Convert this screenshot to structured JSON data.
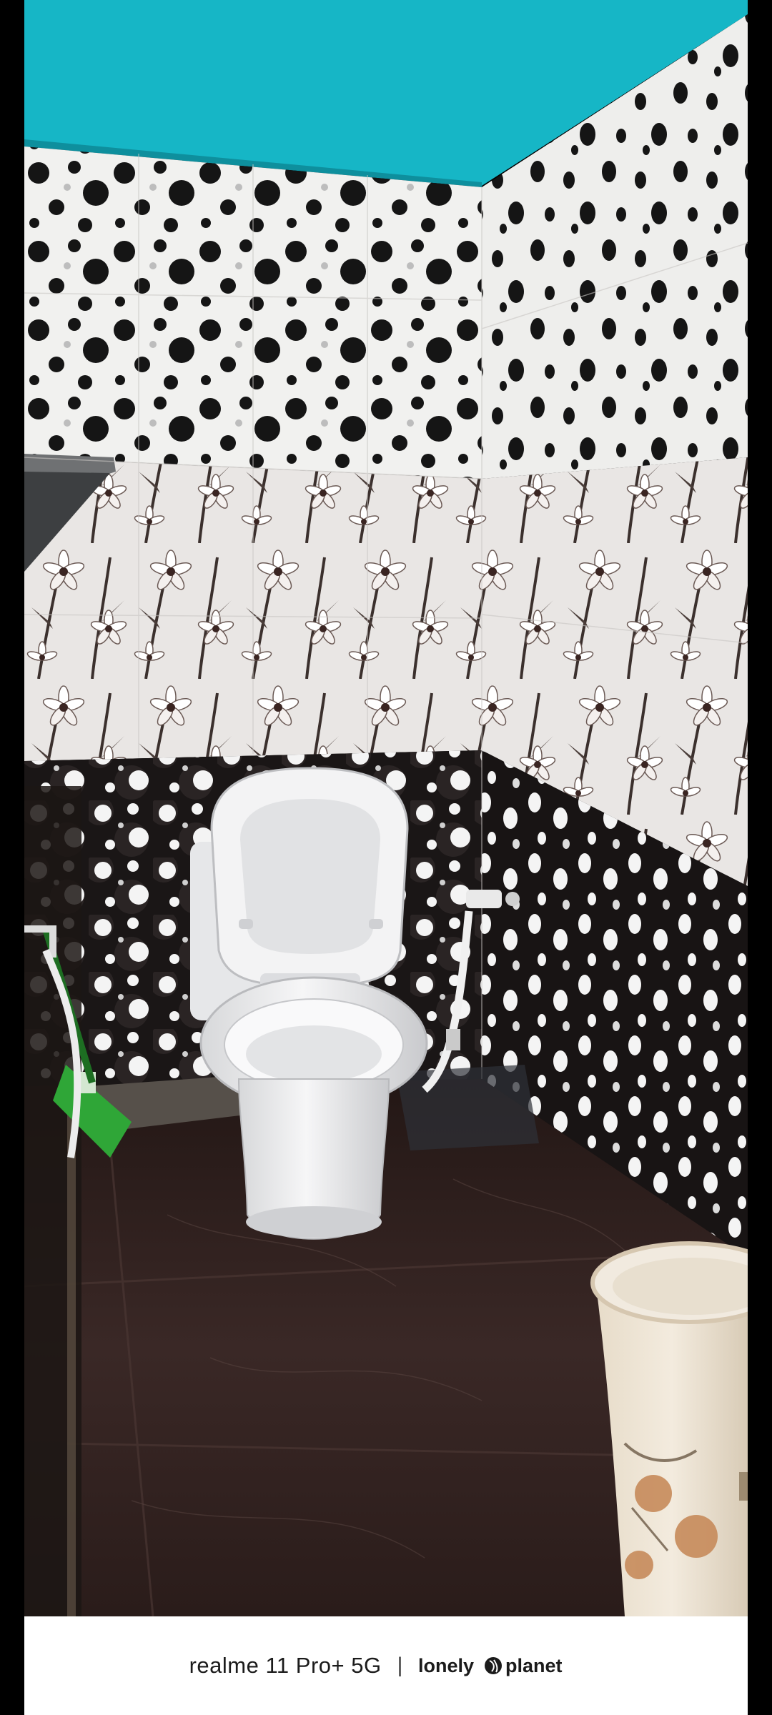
{
  "image": {
    "subject": "bathroom-photo",
    "colors": {
      "ceiling_band": "#16b6c6",
      "polka_wall": "#f1f1ef",
      "dot_dark": "#151515",
      "floral_wall": "#e9e6e4",
      "dark_tile": "#1a1616",
      "dot_light": "#f4f4f4",
      "floor": "#2b1e1c",
      "toilet": "#eeeeef",
      "bucket": "#efe6d8",
      "broom": "#2fa637"
    }
  },
  "watermark": {
    "device": "realme 11 Pro+ 5G",
    "separator": "|",
    "brand": "lonely planet"
  }
}
